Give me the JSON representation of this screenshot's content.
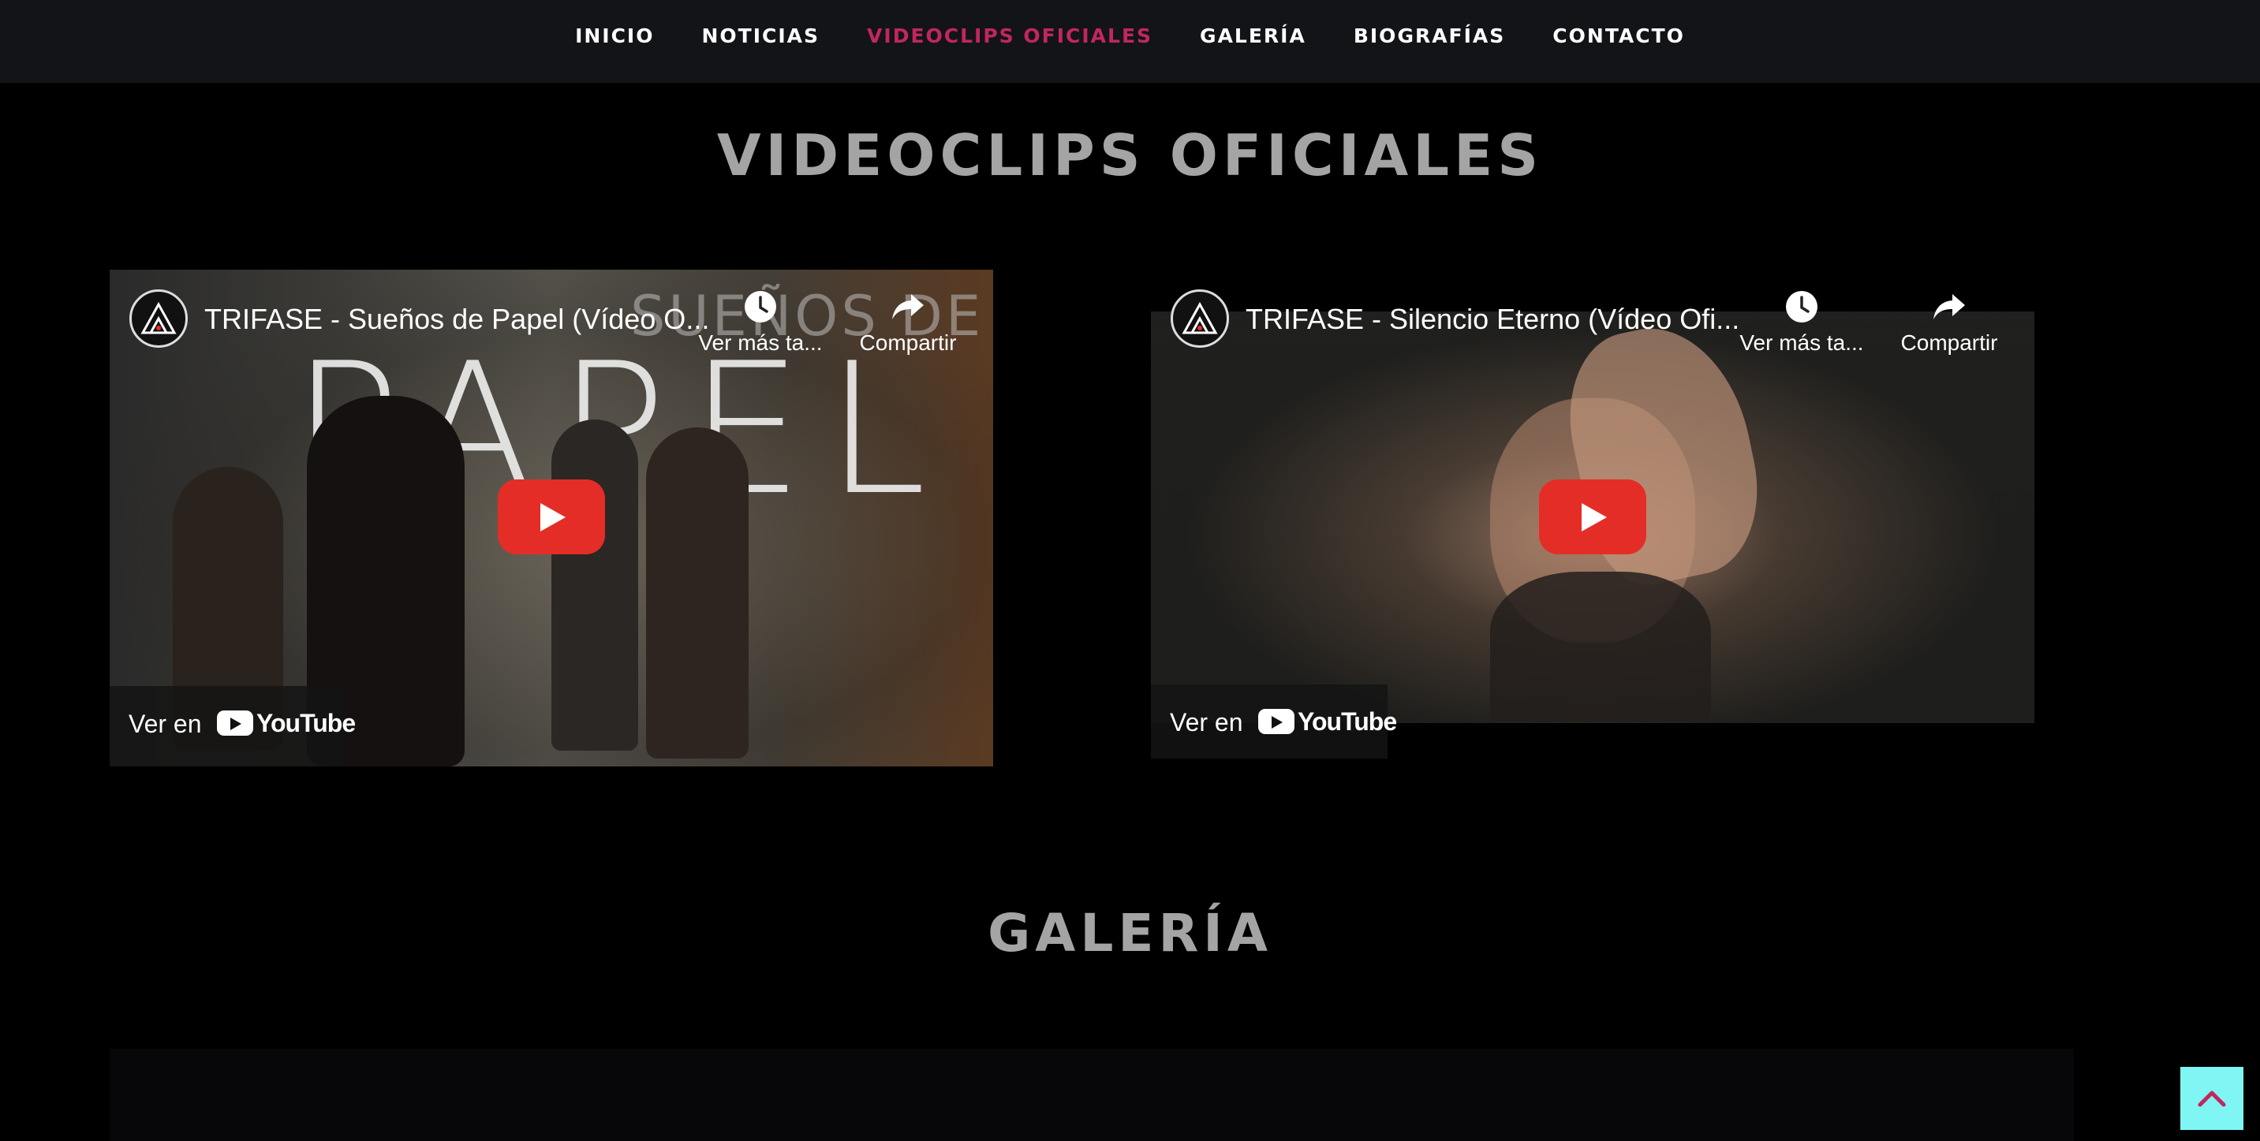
{
  "nav": {
    "items": [
      {
        "label": "INICIO"
      },
      {
        "label": "NOTICIAS"
      },
      {
        "label": "VIDEOCLIPS OFICIALES",
        "active": true
      },
      {
        "label": "GALERÍA"
      },
      {
        "label": "BIOGRAFÍAS"
      },
      {
        "label": "CONTACTO"
      }
    ],
    "active_color": "#c2265f"
  },
  "sections": {
    "videos_title": "VIDEOCLIPS OFICIALES",
    "gallery_title": "GALERÍA"
  },
  "videos": [
    {
      "title": "TRIFASE - Sueños de Papel (Vídeo O...",
      "watch_later": "Ver más ta...",
      "share": "Compartir",
      "watch_on": "Ver en",
      "youtube": "YouTube",
      "thumbnail_text_top": "SUEÑOS DE",
      "thumbnail_text_big": "PAPEL"
    },
    {
      "title": "TRIFASE - Silencio Eterno (Vídeo Ofi...",
      "watch_later": "Ver más ta...",
      "share": "Compartir",
      "watch_on": "Ver en",
      "youtube": "YouTube"
    }
  ],
  "colors": {
    "background": "#000000",
    "navbar": "#131418",
    "title_gray": "#a4a4a4",
    "play_red": "#e52d27",
    "back_to_top": "#7ff6f3"
  },
  "icons": [
    "clock-icon",
    "share-icon",
    "play-icon",
    "youtube-logo-icon",
    "channel-logo-icon",
    "chevron-up-icon"
  ]
}
